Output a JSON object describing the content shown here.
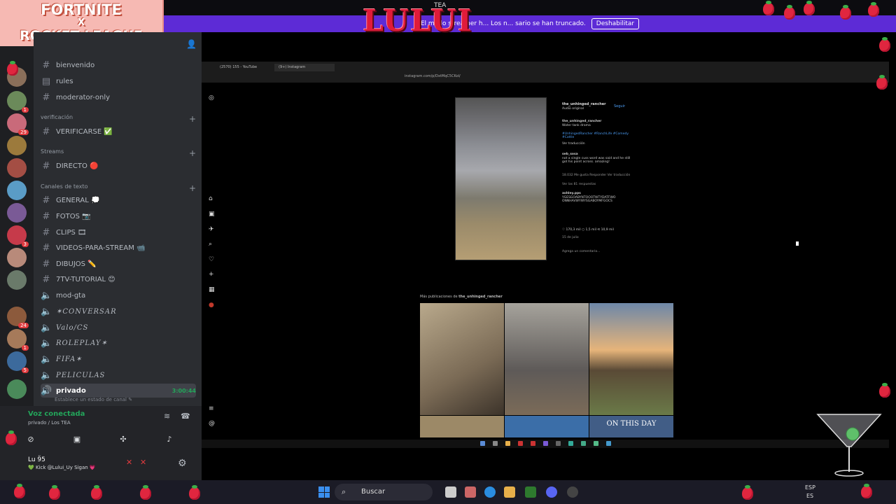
{
  "overlay": {
    "brand_title": "LULUI",
    "fortnite_line1": "FORTNITE",
    "fortnite_line2": "X",
    "fortnite_line3": "ROCKET LEAGUE",
    "top_small": "TEA"
  },
  "notice": {
    "text": "El modo streamer h... Los n... sario se han truncado.",
    "button": "Deshabilitar",
    "color": "#5d2bd6"
  },
  "servers": {
    "badges": [
      "1",
      "29",
      "3",
      "24",
      "1",
      "5"
    ]
  },
  "channels": {
    "items_top": [
      {
        "icon": "#",
        "label": "bienvenido"
      },
      {
        "icon": "▤",
        "label": "rules"
      },
      {
        "icon": "#",
        "label": "moderator-only"
      }
    ],
    "cat_verificacion": "verificación",
    "verificarse": "VERIFICARSE ✅",
    "cat_streams": "Streams",
    "directo": "DIRECTO 🔴",
    "cat_texto": "Canales de texto",
    "text_channels": [
      {
        "icon": "#",
        "label": "GENERAL 💭"
      },
      {
        "icon": "#",
        "label": "FOTOS 📷"
      },
      {
        "icon": "#",
        "label": "CLIPS 🎞"
      },
      {
        "icon": "#",
        "label": "VIDEOS-PARA-STREAM 📹"
      },
      {
        "icon": "#",
        "label": "DIBUJOS ✏️"
      },
      {
        "icon": "#",
        "label": "7TV-TUTORIAL 😊"
      },
      {
        "icon": "#",
        "label": "mod-gta"
      }
    ],
    "voice_channels": [
      "✶CONVERSAR",
      "Valo/CS",
      "ROLEPLAY✶",
      "FIFA✶",
      "PELICULAS"
    ],
    "active": {
      "label": "privado",
      "timer": "3:00:44"
    },
    "status_hint": "Establece un estado de canal ✎"
  },
  "voice": {
    "connected": "Voz conectada",
    "location": "privado / Los TEA"
  },
  "user": {
    "name": "Lu 9̈5",
    "status": "💚 Kick @Lului_Uy Sigan 💗"
  },
  "browser": {
    "tab1": "(2570) 155 - YouTube",
    "tab2": "(9+) Instagram",
    "url": "instagram.com/p/DxtMqC5CKol/"
  },
  "post": {
    "username": "the_unhinged_rancher",
    "audio": "Audio original",
    "follow": "Seguir",
    "caption_user": "the_unhinged_rancher",
    "caption_time": "2 sem",
    "caption": "Water tank drama",
    "hashtags": "#UnhingedRancher #RanchLife #Comedy #Cattle",
    "see_translation": "Ver traducción",
    "comment1_user": "seb_sosa",
    "comment1": "not a single cuss word was said and he still got his point across. amazing!",
    "comment1_meta": "18.032 Me gusta  Responder  Ver traducción",
    "replies": "Ver las 81 respuestas",
    "comment2_user": "ashley.pps",
    "comment2": "YGESGOABYNTOOOTWTYDATFWO ONNHAVWYWYSGABOYMFGOCS",
    "likes": "170,3 mil",
    "comments_count": "1,5 mil",
    "reposts": "10,9 mil",
    "date": "15 de julio",
    "add_comment": "Agrega un comentario..."
  },
  "more": {
    "title_prefix": "Más publicaciones de",
    "title_user": "the_unhinged_rancher",
    "last_thumb_text": "ON THIS DAY"
  },
  "taskbar": {
    "search": "Buscar",
    "lang": "ESP",
    "lang2": "ES"
  }
}
